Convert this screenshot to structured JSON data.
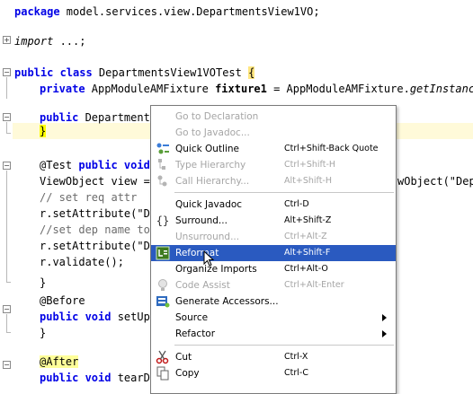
{
  "editor": {
    "package_kw": "package",
    "package_name": " model.services.view.DepartmentsView1VO;",
    "import_kw": "import",
    "import_rest": " ...;",
    "class_mods": "public class",
    "class_name": " DepartmentsView1VOTest ",
    "class_brace": "{",
    "fixture_mod": "private",
    "fixture_type": " AppModuleAMFixture ",
    "fixture_name": "fixture1",
    "fixture_eq": " = AppModuleAMFixture.",
    "fixture_call": "getInstance",
    "fixture_paren": "(",
    "ctor_mod": "public",
    "ctor_name": " Departments",
    "ctor_close": "}",
    "test_ann": "@Test",
    "test_mods": " public void",
    "test_rest": " ",
    "vo_line": "ViewObject view = ",
    "vo_line_right": "wObject(\"Dep",
    "cmt1": "// set req attr",
    "set1": "r.setAttribute(\"De",
    "cmt2": "//set dep name to",
    "set2": "r.setAttribute(\"De",
    "validate": "r.validate();",
    "close1": "}",
    "before_ann": "@Before",
    "setup_mods": "public void",
    "setup_name": " setUp(",
    "close2": "}",
    "after_ann": "@After",
    "teardown_mods": "public void",
    "teardown_name": " tearDo"
  },
  "menu": {
    "items": [
      {
        "label": "Go to Declaration",
        "shortcut": "",
        "disabled": true,
        "icon": "none"
      },
      {
        "label": "Go to Javadoc...",
        "shortcut": "",
        "disabled": true,
        "icon": "none"
      },
      {
        "label": "Quick Outline",
        "shortcut": "Ctrl+Shift-Back Quote",
        "disabled": false,
        "icon": "outline-icon"
      },
      {
        "label": "Type Hierarchy",
        "shortcut": "Ctrl+Shift-H",
        "disabled": true,
        "icon": "hierarchy-icon"
      },
      {
        "label": "Call Hierarchy...",
        "shortcut": "Alt+Shift-H",
        "disabled": true,
        "icon": "call-hierarchy-icon"
      },
      {
        "label": "Quick Javadoc",
        "shortcut": "Ctrl-D",
        "disabled": false,
        "icon": "none"
      },
      {
        "label": "Surround...",
        "shortcut": "Alt+Shift-Z",
        "disabled": false,
        "icon": "braces-icon"
      },
      {
        "label": "Unsurround...",
        "shortcut": "Ctrl+Alt-Z",
        "disabled": true,
        "icon": "none"
      },
      {
        "label": "Reformat",
        "shortcut": "Alt+Shift-F",
        "disabled": false,
        "icon": "reformat-icon"
      },
      {
        "label": "Organize Imports",
        "shortcut": "Ctrl+Alt-O",
        "disabled": false,
        "icon": "none"
      },
      {
        "label": "Code Assist",
        "shortcut": "Ctrl+Alt-Enter",
        "disabled": true,
        "icon": "bulb-icon"
      },
      {
        "label": "Generate Accessors...",
        "shortcut": "",
        "disabled": false,
        "icon": "accessors-icon"
      },
      {
        "label": "Source",
        "shortcut": "",
        "disabled": false,
        "icon": "none"
      },
      {
        "label": "Refactor",
        "shortcut": "",
        "disabled": false,
        "icon": "none"
      },
      {
        "label": "Cut",
        "shortcut": "Ctrl-X",
        "disabled": false,
        "icon": "scissors-icon"
      },
      {
        "label": "Copy",
        "shortcut": "Ctrl-C",
        "disabled": false,
        "icon": "copy-icon"
      }
    ],
    "selected": "Reformat"
  },
  "colors": {
    "keyword": "#0000e6",
    "selection": "#2a5ac0",
    "line_highlight": "#fffad9",
    "annotation_bg": "#ffff99"
  }
}
